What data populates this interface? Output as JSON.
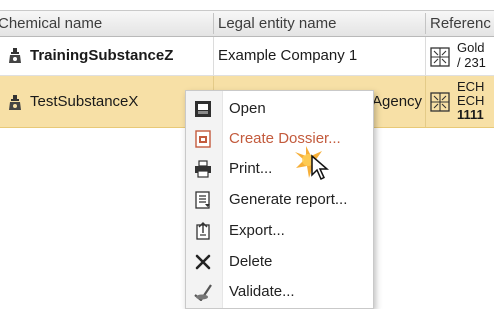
{
  "table": {
    "columns": [
      "Chemical name",
      "Legal entity name",
      "Referenc"
    ],
    "rows": [
      {
        "chemical_name": "TrainingSubstanceZ",
        "legal_entity": "Example Company 1",
        "reference_lines": [
          "Gold",
          "/ 231"
        ]
      },
      {
        "chemical_name": "TestSubstanceX",
        "legal_entity": "Agency",
        "reference_lines": [
          "ECH",
          "ECH",
          "1111"
        ]
      }
    ]
  },
  "context_menu": {
    "items": [
      {
        "label": "Open",
        "icon": "open-icon",
        "state": "enabled"
      },
      {
        "label": "Create Dossier...",
        "icon": "create-dossier-icon",
        "state": "hover"
      },
      {
        "label": "Print...",
        "icon": "print-icon",
        "state": "enabled"
      },
      {
        "label": "Generate report...",
        "icon": "report-icon",
        "state": "enabled"
      },
      {
        "label": "Export...",
        "icon": "export-icon",
        "state": "enabled"
      },
      {
        "label": "Delete",
        "icon": "delete-icon",
        "state": "enabled"
      },
      {
        "label": "Validate...",
        "icon": "validate-icon",
        "state": "enabled"
      }
    ]
  },
  "colors": {
    "selected_row": "#f7e0a6",
    "menu_highlight_text": "#c35b3d",
    "cursor_highlight": "#f5a623"
  }
}
